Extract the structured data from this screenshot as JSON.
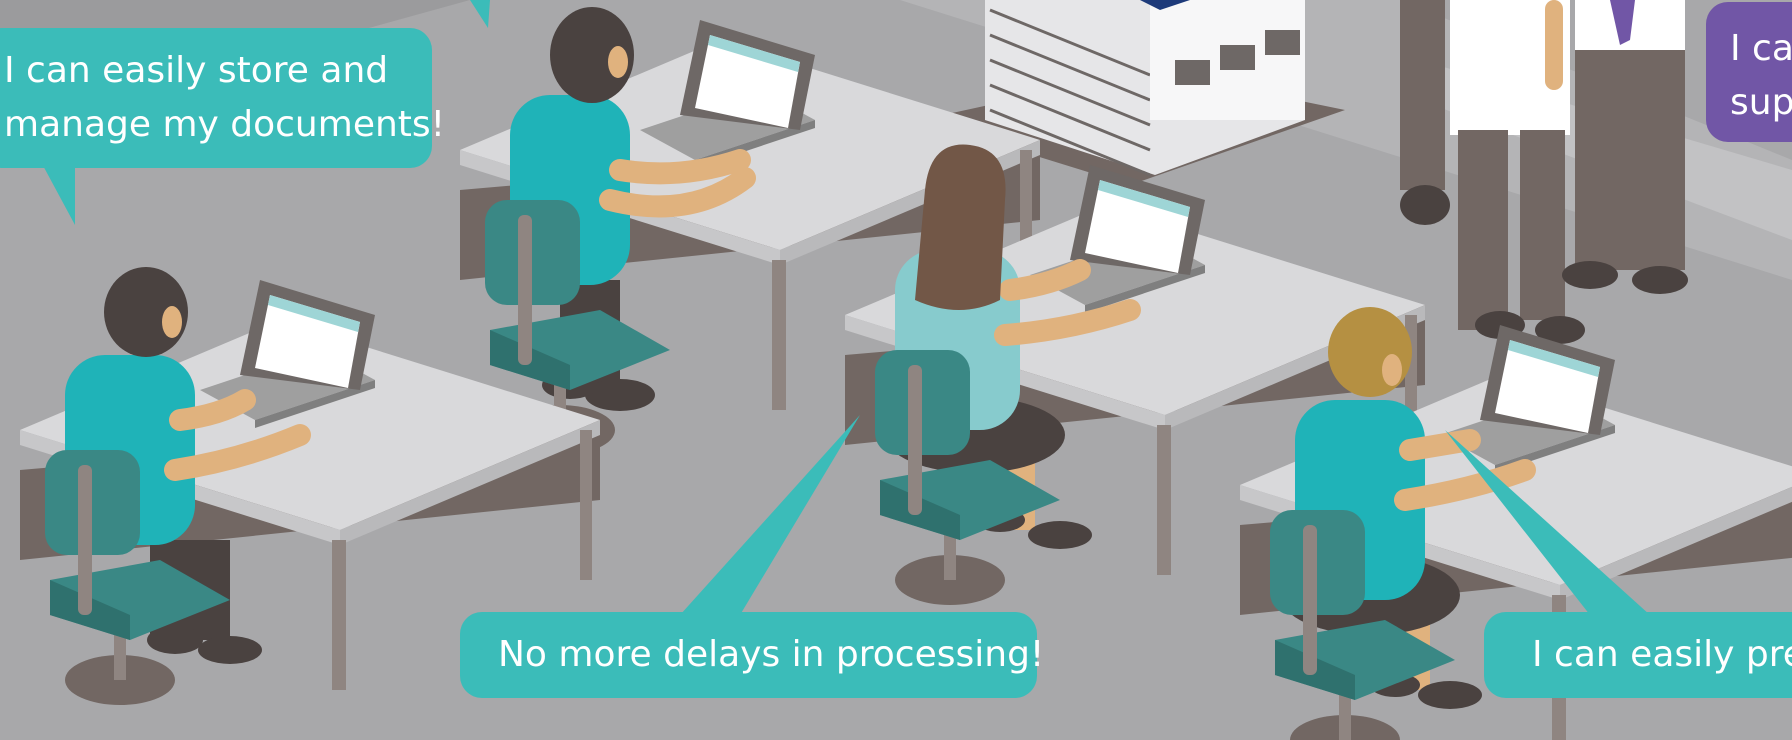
{
  "speech_bubbles": [
    {
      "lines": [
        "I can easily store and",
        "manage my documents!"
      ],
      "color": "#3bbcb9"
    },
    {
      "lines": [
        "No more delays in processing!"
      ],
      "color": "#3bbcb9"
    },
    {
      "lines": [
        "I can easily prep"
      ],
      "color": "#3bbcb9"
    },
    {
      "lines": [
        "I ca",
        "sup"
      ],
      "color": "#7156a6"
    }
  ],
  "colors": {
    "background": "#a8a8aa",
    "floor": "#a8a8aa",
    "desk_top": "#d9d9db",
    "desk_side": "#726763",
    "chair": "#3a8885",
    "shirt_teal": "#1fb3b8",
    "skin": "#e0b27e",
    "laptop": "#9f9f9f",
    "screen": "#ffffff"
  }
}
